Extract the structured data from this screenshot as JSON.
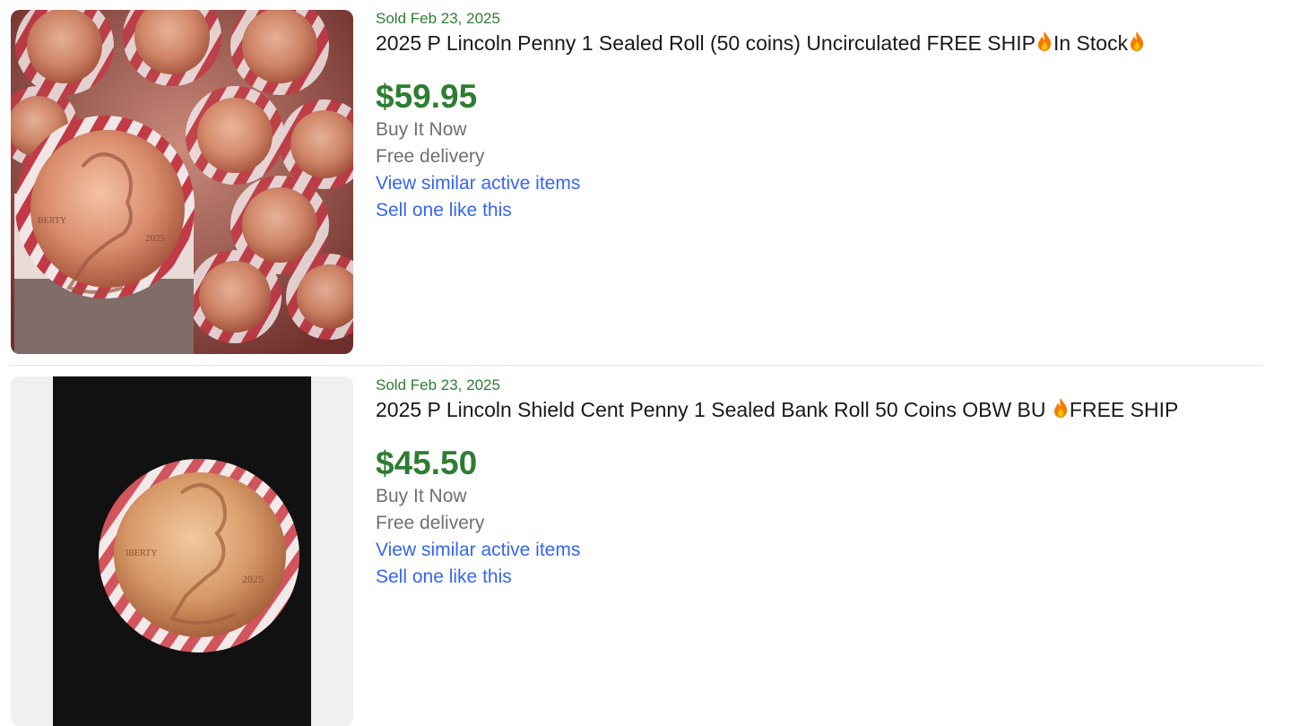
{
  "listings": [
    {
      "sold_date": "Sold Feb 23, 2025",
      "title_part1": "2025 P Lincoln Penny 1 Sealed Roll (50 coins) Uncirculated FREE SHIP",
      "title_part2": "In Stock",
      "price": "$59.95",
      "format": "Buy It Now",
      "delivery": "Free delivery",
      "similar_link": "View similar active items",
      "sell_link": "Sell one like this",
      "image_icon": "penny-roll-photo-icon"
    },
    {
      "sold_date": "Sold Feb 23, 2025",
      "title_part1": "2025 P Lincoln Shield Cent Penny 1 Sealed Bank Roll 50 Coins OBW BU ",
      "title_part2": "FREE SHIP",
      "price": "$45.50",
      "format": "Buy It Now",
      "delivery": "Free delivery",
      "similar_link": "View similar active items",
      "sell_link": "Sell one like this",
      "image_icon": "penny-roll-photo-icon"
    }
  ],
  "colors": {
    "sold_green": "#2e7d32",
    "link_blue": "#3665f3",
    "muted_grey": "#707070",
    "title_text": "#191919"
  },
  "emoji_icon": "fire-icon"
}
